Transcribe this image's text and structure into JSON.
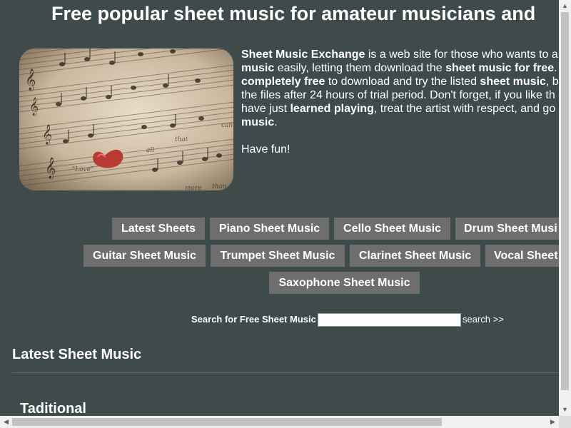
{
  "page": {
    "title": "Free popular sheet music for amateur musicians and"
  },
  "hero": {
    "image_alt": "sheet music with a heart",
    "image_words": [
      "can",
      "\"Love\"",
      "all",
      "that",
      "more",
      "than"
    ]
  },
  "intro": {
    "para1": [
      {
        "t": "Sheet Music Exchange",
        "b": true
      },
      {
        "t": " is a web site for those who wants to a",
        "b": false
      },
      {
        "br": true
      },
      {
        "t": "music",
        "b": true
      },
      {
        "t": " easily, letting them download the ",
        "b": false
      },
      {
        "t": "sheet music for free",
        "b": true
      },
      {
        "t": ". b",
        "b": false
      },
      {
        "br": true
      },
      {
        "t": "completely free",
        "b": true
      },
      {
        "t": " to download and try the listed ",
        "b": false
      },
      {
        "t": "sheet music",
        "b": true
      },
      {
        "t": ", b",
        "b": false
      },
      {
        "br": true
      },
      {
        "t": "the files after 24 hours of trial period. Don't forget, if you like th",
        "b": false
      },
      {
        "br": true
      },
      {
        "t": "have just ",
        "b": false
      },
      {
        "t": "learned playing",
        "b": true
      },
      {
        "t": ", treat the artist with respect, and go",
        "b": false
      },
      {
        "br": true
      },
      {
        "t": "music",
        "b": true
      },
      {
        "t": ".",
        "b": false
      }
    ],
    "para2": "Have fun!"
  },
  "categories": {
    "row1": [
      "Latest Sheets",
      "Piano Sheet Music",
      "Cello Sheet Music",
      "Drum Sheet Musi"
    ],
    "row2": [
      "Guitar Sheet Music",
      "Trumpet Sheet Music",
      "Clarinet Sheet Music",
      "Vocal Sheet"
    ],
    "row3": [
      "Saxophone Sheet Music"
    ]
  },
  "search": {
    "label": "Search for Free Sheet Music",
    "value": "",
    "placeholder": "",
    "link": "search >>"
  },
  "latest": {
    "heading": "Latest Sheet Music",
    "subheading": "Taditional"
  },
  "scrollbars": {
    "up_icon": "▲",
    "down_icon": "▼",
    "left_icon": "◀",
    "right_icon": "▶"
  }
}
